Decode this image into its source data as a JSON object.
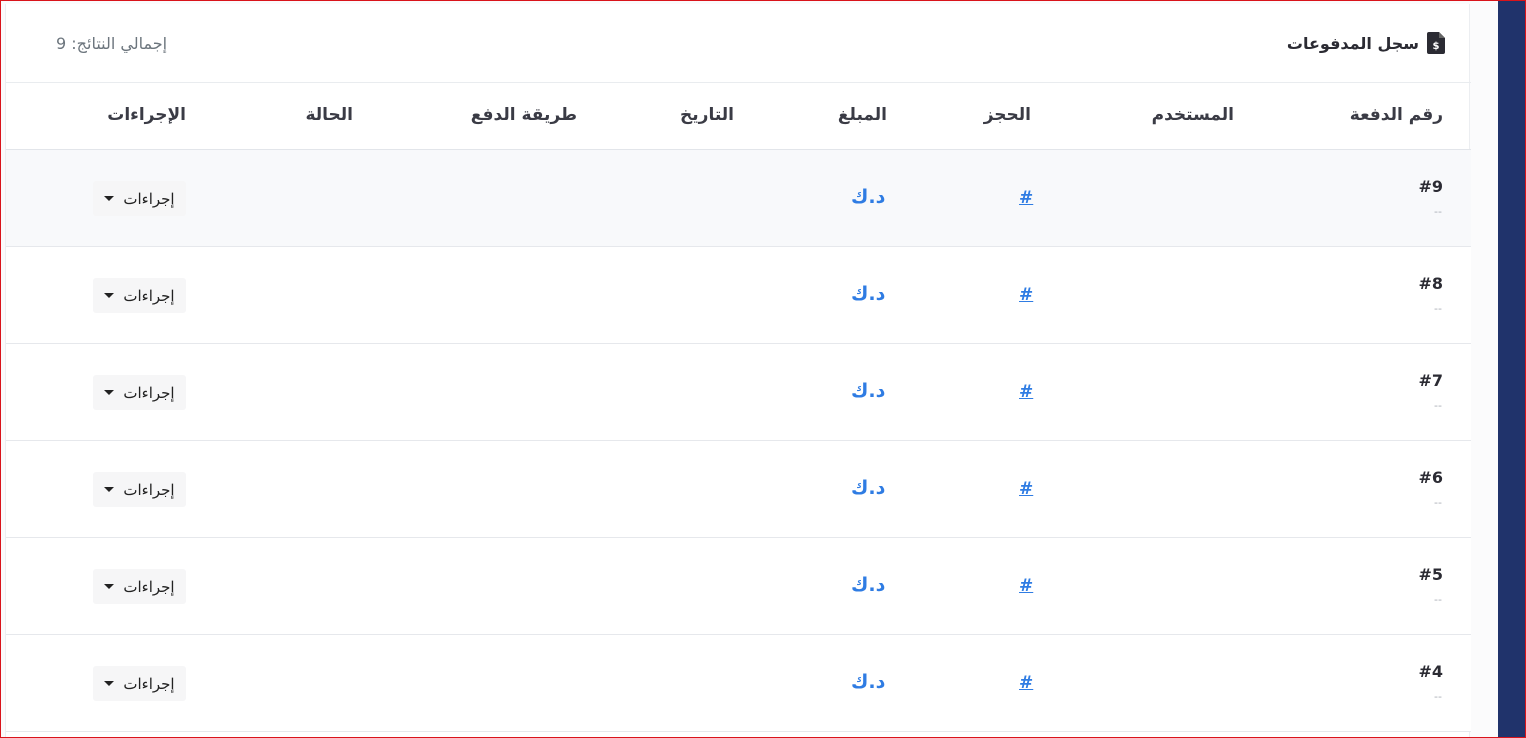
{
  "header": {
    "title": "سجل المدفوعات",
    "title_icon": "file-invoice-dollar-icon",
    "total_results": "إجمالي النتائج: 9"
  },
  "table": {
    "columns": [
      "رقم الدفعة",
      "المستخدم",
      "الحجز",
      "المبلغ",
      "التاريخ",
      "طريقة الدفع",
      "الحالة",
      "الإجراءات"
    ],
    "rows": [
      {
        "id": "#9",
        "sub": "--",
        "booking": "#",
        "amount": "د.ك",
        "action": "إجراءات"
      },
      {
        "id": "#8",
        "sub": "--",
        "booking": "#",
        "amount": "د.ك",
        "action": "إجراءات"
      },
      {
        "id": "#7",
        "sub": "--",
        "booking": "#",
        "amount": "د.ك",
        "action": "إجراءات"
      },
      {
        "id": "#6",
        "sub": "--",
        "booking": "#",
        "amount": "د.ك",
        "action": "إجراءات"
      },
      {
        "id": "#5",
        "sub": "--",
        "booking": "#",
        "amount": "د.ك",
        "action": "إجراءات"
      },
      {
        "id": "#4",
        "sub": "--",
        "booking": "#",
        "amount": "د.ك",
        "action": "إجراءات"
      }
    ]
  },
  "colors": {
    "link": "#2f7ce3",
    "sidebar": "#20336b",
    "frame_border": "#d9141b"
  }
}
